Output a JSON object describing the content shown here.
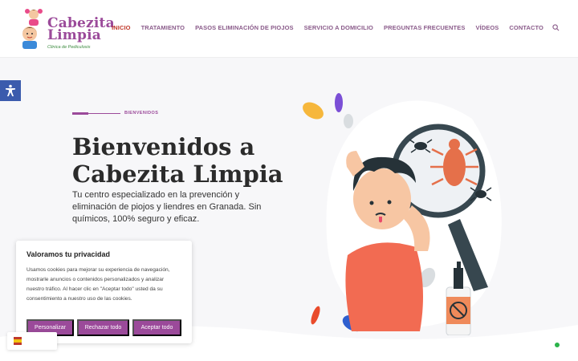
{
  "header": {
    "logo": {
      "title_line1": "Cabezita",
      "title_line2": "Limpia",
      "subtitle": "Clinica de Pediculosis"
    },
    "nav": [
      {
        "label": "INICIO",
        "active": true
      },
      {
        "label": "TRATAMIENTO"
      },
      {
        "label": "PASOS ELIMINACIÓN DE PIOJOS"
      },
      {
        "label": "SERVICIO A DOMICILIO"
      },
      {
        "label": "PREGUNTAS FRECUENTES"
      },
      {
        "label": "VÍDEOS"
      },
      {
        "label": "CONTACTO"
      }
    ],
    "search_icon": "search-icon"
  },
  "accessibility": {
    "icon": "accessibility-icon"
  },
  "hero": {
    "eyebrow": "BIENVENIDOS",
    "title_line1": "Bienvenidos a",
    "title_line2": "Cabezita Limpia",
    "description": "Tu centro especializado en la prevención y eliminación de piojos y liendres en Granada. Sin químicos, 100% seguro y eficaz."
  },
  "cookie": {
    "title": "Valoramos tu privacidad",
    "text": "Usamos cookies para mejorar su experiencia de navegación, mostrarle anuncios o contenidos personalizados y analizar nuestro tráfico. Al hacer clic en \"Aceptar todo\" usted da su consentimiento a nuestro uso de las cookies.",
    "buttons": {
      "customize": "Personalizar",
      "reject": "Rechazar todo",
      "accept": "Aceptar todo"
    }
  },
  "colors": {
    "brand": "#9b4a9a",
    "active_nav": "#c0392b",
    "accessibility": "#3b5bad",
    "status_badge": "#2bb34a"
  }
}
